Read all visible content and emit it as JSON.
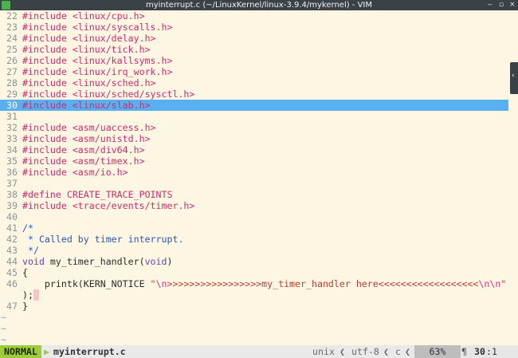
{
  "window": {
    "title": "myinterrupt.c (~/LinuxKernel/linux-3.9.4/mykernel) - VIM",
    "minimize": "‒",
    "restore": "▫",
    "close": "×"
  },
  "editor": {
    "lines": [
      {
        "num": "22",
        "pre": "#include",
        "arg": " <linux/cpu.h>"
      },
      {
        "num": "23",
        "pre": "#include",
        "arg": " <linux/syscalls.h>"
      },
      {
        "num": "24",
        "pre": "#include",
        "arg": " <linux/delay.h>"
      },
      {
        "num": "25",
        "pre": "#include",
        "arg": " <linux/tick.h>"
      },
      {
        "num": "26",
        "pre": "#include",
        "arg": " <linux/kallsyms.h>"
      },
      {
        "num": "27",
        "pre": "#include",
        "arg": " <linux/irq_work.h>"
      },
      {
        "num": "28",
        "pre": "#include",
        "arg": " <linux/sched.h>"
      },
      {
        "num": "29",
        "pre": "#include",
        "arg": " <linux/sched/sysctl.h>"
      },
      {
        "num": "30",
        "pre": "#include",
        "arg": " <linux/slab.h>"
      },
      {
        "num": "31"
      },
      {
        "num": "32",
        "pre": "#include",
        "arg": " <asm/uaccess.h>"
      },
      {
        "num": "33",
        "pre": "#include",
        "arg": " <asm/unistd.h>"
      },
      {
        "num": "34",
        "pre": "#include",
        "arg": " <asm/div64.h>"
      },
      {
        "num": "35",
        "pre": "#include",
        "arg": " <asm/timex.h>"
      },
      {
        "num": "36",
        "pre": "#include",
        "arg": " <asm/io.h>"
      },
      {
        "num": "37"
      },
      {
        "num": "38",
        "pre": "#define",
        "arg": " CREATE_TRACE_POINTS"
      },
      {
        "num": "39",
        "pre": "#include",
        "arg": " <trace/events/timer.h>"
      },
      {
        "num": "40"
      },
      {
        "num": "41",
        "cm": "/*"
      },
      {
        "num": "42",
        "cm": " * Called by timer interrupt."
      },
      {
        "num": "43",
        "cm": " */"
      },
      {
        "num": "44",
        "ty": "void",
        "nm": " my_timer_handler(",
        "ty2": "void",
        "nm2": ")"
      },
      {
        "num": "45",
        "nm": "{"
      },
      {
        "num": "46",
        "nm": "    printk(KERN_NOTICE ",
        "s1": "\"",
        "e1": "\\n",
        "s2": ">>>>>>>>>>>>>>>>>my_timer_handler here<<<<<<<<<<<<<<<<<<",
        "e2": "\\n\\n",
        "s3": "\""
      },
      {
        "num": "",
        "nm": ");"
      },
      {
        "num": "47",
        "nm": "}"
      }
    ],
    "cursor_line": "30",
    "tildes": [
      "~",
      "~",
      "~"
    ],
    "highlight_color": "#58b0f0"
  },
  "statusbar": {
    "mode": "NORMAL",
    "filename": "myinterrupt.c",
    "fileformat": "unix",
    "encoding": "utf-8",
    "filetype": "c",
    "percent": "63%",
    "line": "30",
    "col": ":1",
    "mode_color": "#9ccc3a"
  },
  "scrollbar": {
    "icon": "chevron-left-icon",
    "glyph": "‹"
  }
}
